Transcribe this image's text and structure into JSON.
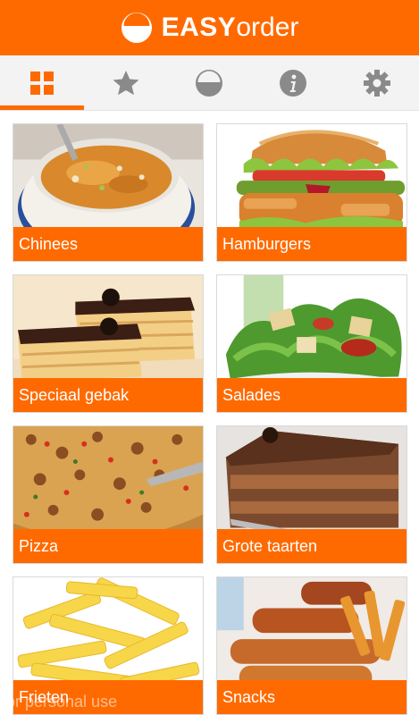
{
  "header": {
    "brand_bold": "EASY",
    "brand_light": "order",
    "color": "#ff6a00"
  },
  "tabs": [
    {
      "icon": "grid-icon",
      "active": true
    },
    {
      "icon": "star-icon",
      "active": false
    },
    {
      "icon": "half-circle-icon",
      "active": false
    },
    {
      "icon": "info-icon",
      "active": false
    },
    {
      "icon": "gear-icon",
      "active": false
    }
  ],
  "categories": [
    {
      "label": "Chinees",
      "image": "soup"
    },
    {
      "label": "Hamburgers",
      "image": "burger"
    },
    {
      "label": "Speciaal gebak",
      "image": "pastry"
    },
    {
      "label": "Salades",
      "image": "salad"
    },
    {
      "label": "Pizza",
      "image": "pizza"
    },
    {
      "label": "Grote taarten",
      "image": "cake"
    },
    {
      "label": "Frieten",
      "image": "fries"
    },
    {
      "label": "Snacks",
      "image": "snacks"
    }
  ],
  "watermark": "for personal use"
}
